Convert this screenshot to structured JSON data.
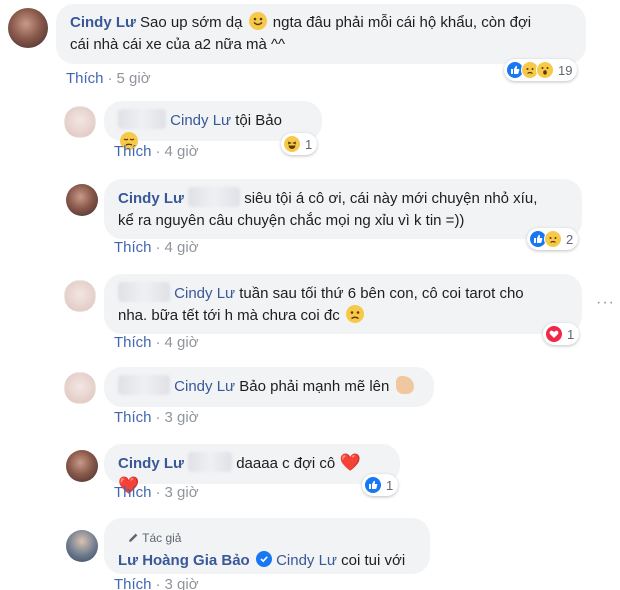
{
  "comments": [
    {
      "author": "Cindy Lư",
      "text_before": "Sao up sớm dạ",
      "text_after": "ngta đâu phải mỗi cái hộ khẩu, còn đợi",
      "text_line2": "cái nhà cái xe của a2 nữa mà ^^",
      "like": "Thích",
      "time": "5 giờ",
      "reaction_count": "19"
    },
    {
      "mention": "Cindy Lư",
      "text": "tội Bảo",
      "like": "Thích",
      "time": "4 giờ",
      "reaction_count": "1"
    },
    {
      "author": "Cindy Lư",
      "text_line1": "siêu tội á cô ơi, cái này mới chuyện nhỏ xíu,",
      "text_line2": "kể ra nguyên câu chuyện chắc mọi ng xỉu vì k tin =))",
      "like": "Thích",
      "time": "4 giờ",
      "reaction_count": "2"
    },
    {
      "mention": "Cindy Lư",
      "text_line1": "tuần sau tối thứ 6 bên con, cô coi tarot cho",
      "text_line2": "nha. bữa tết tới h mà chưa coi đc",
      "like": "Thích",
      "time": "4 giờ",
      "reaction_count": "1"
    },
    {
      "mention": "Cindy Lư",
      "text": "Bảo phải mạnh mẽ lên",
      "like": "Thích",
      "time": "3 giờ"
    },
    {
      "author": "Cindy Lư",
      "text": "daaaa c đợi cô",
      "hearts": "❤️ ❤️",
      "like": "Thích",
      "time": "3 giờ",
      "reaction_count": "1"
    },
    {
      "author_tag": "Tác giả",
      "author": "Lư Hoàng Gia Bảo",
      "mention": "Cindy Lư",
      "text": "coi tui với",
      "like": "Thích",
      "time": "3 giờ"
    }
  ],
  "separator": "·",
  "more_menu": "···",
  "colors": {
    "name_blue": "#385898",
    "bubble_bg": "#f2f3f5",
    "meta_gray": "#90949c",
    "like_blue": "#1877f2"
  }
}
